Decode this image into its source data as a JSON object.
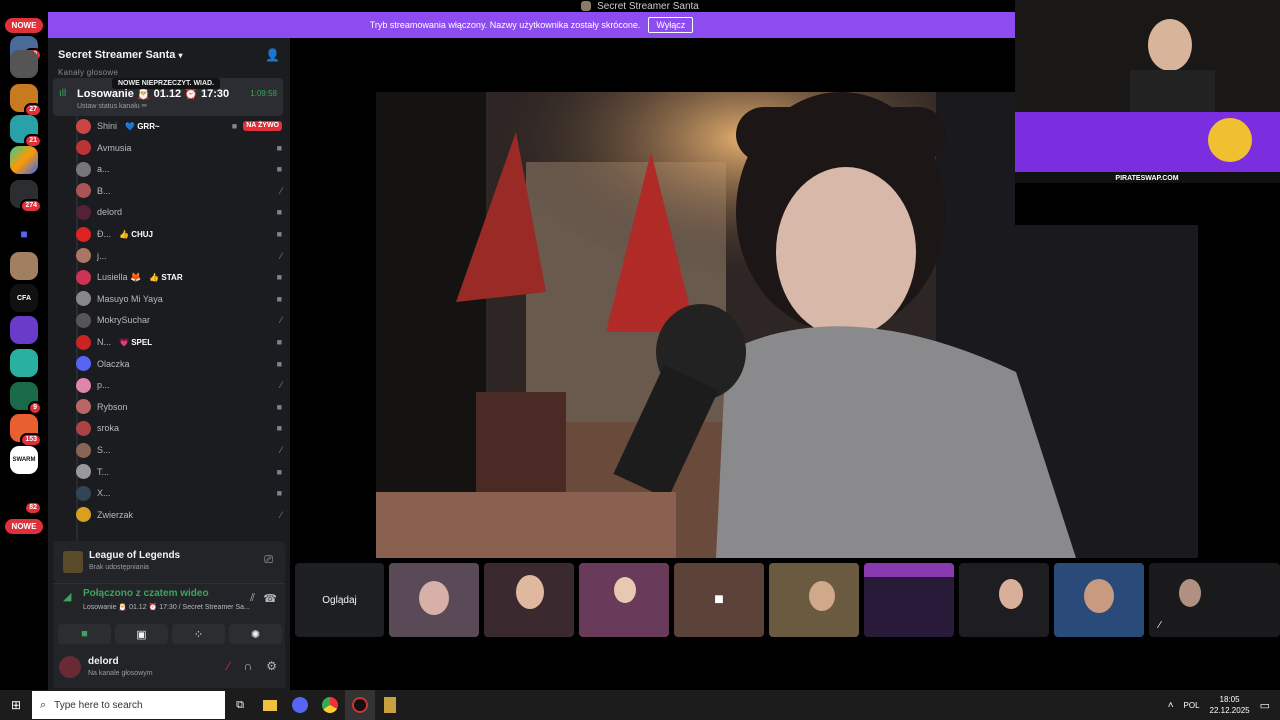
{
  "window_title": "Secret Streamer Santa",
  "banner": {
    "text": "Tryb streamowania włączony. Nazwy użytkownika zostały skrócone.",
    "button": "Wyłącz"
  },
  "rail": {
    "nowe_top": "NOWE",
    "nowe_bottom": "NOWE",
    "badges": [
      "19",
      "27",
      "21",
      "274",
      "9",
      "153",
      "82"
    ]
  },
  "server": {
    "name": "Secret Streamer Santa",
    "category": "Kanały głosowe"
  },
  "tooltip": "NOWE NIEPRZECZYT. WIAD.",
  "voice_channel": {
    "name": "Losowanie 🎅 01.12 ⏰ 17:30",
    "time": "1:09:58",
    "status": "Ustaw status kanału ✏"
  },
  "members": [
    {
      "name": "Shini",
      "tag": "💙 GRR~",
      "live": "NA ŻYWO",
      "color": "#c44"
    },
    {
      "name": "Avmusia",
      "tag": "",
      "color": "#b33"
    },
    {
      "name": "a...",
      "tag": "",
      "color": "#777"
    },
    {
      "name": "B...",
      "tag": "",
      "color": "#a55"
    },
    {
      "name": "delord",
      "tag": "",
      "color": "#523"
    },
    {
      "name": "Ð...",
      "tag": "👍 CHUJ",
      "color": "#d22"
    },
    {
      "name": "j...",
      "tag": "",
      "color": "#a76"
    },
    {
      "name": "Lusiella 🦊",
      "tag": "👍 STAR",
      "color": "#c35"
    },
    {
      "name": "Masuyo Mi Yaya",
      "tag": "",
      "color": "#888"
    },
    {
      "name": "MokrySuchar",
      "tag": "",
      "color": "#555"
    },
    {
      "name": "N...",
      "tag": "💗 SPEL",
      "color": "#c22"
    },
    {
      "name": "Olaczka",
      "tag": "",
      "color": "#5865f2"
    },
    {
      "name": "p...",
      "tag": "",
      "color": "#d8a"
    },
    {
      "name": "Rybson",
      "tag": "",
      "color": "#b66"
    },
    {
      "name": "sroka",
      "tag": "",
      "color": "#a44"
    },
    {
      "name": "S...",
      "tag": "",
      "color": "#865"
    },
    {
      "name": "T...",
      "tag": "",
      "color": "#999"
    },
    {
      "name": "X...",
      "tag": "",
      "color": "#345"
    },
    {
      "name": "Zwierzak",
      "tag": "",
      "color": "#d9a020"
    }
  ],
  "activity": {
    "title": "League of Legends",
    "sub": "Brak udostępniania"
  },
  "voice_connection": {
    "status": "Połączono z czatem wideo",
    "channel": "Losowanie 🎅 01.12 ⏰ 17:30 / Secret Streamer Sa..."
  },
  "user": {
    "name": "delord",
    "status": "Na kanale głosowym"
  },
  "stage": {
    "watch_button": "Oglądaj",
    "pip_text": "PIRATESWAP.COM"
  },
  "taskbar": {
    "search_placeholder": "Type here to search",
    "lang": "POL",
    "time": "18:05",
    "date": "22.12.2025"
  }
}
